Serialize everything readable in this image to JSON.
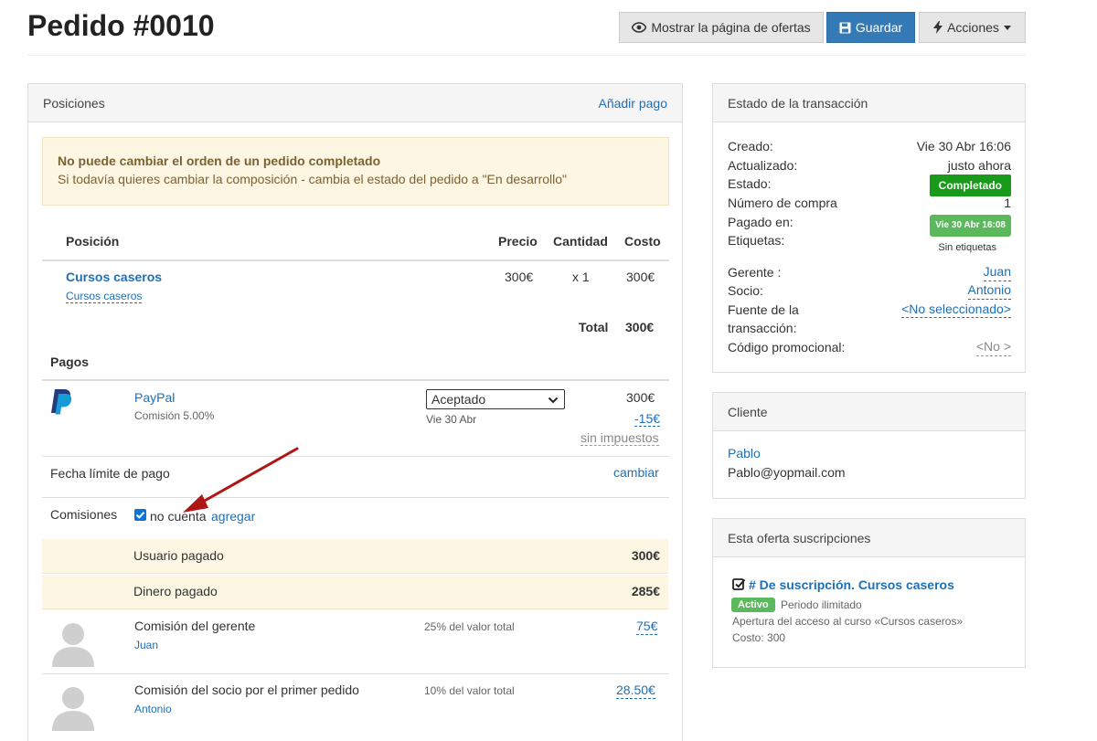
{
  "header": {
    "title": "Pedido #0010",
    "show_offers_label": "Mostrar la página de ofertas",
    "save_label": "Guardar",
    "actions_label": "Acciones"
  },
  "positions": {
    "heading": "Posiciones",
    "add_payment": "Añadir pago",
    "alert_title": "No puede cambiar el orden de un pedido completado",
    "alert_text": "Si todavía quieres cambiar la composición - cambia el estado del pedido a \"En desarrollo\"",
    "columns": {
      "position": "Posición",
      "price": "Precio",
      "quantity": "Cantidad",
      "cost": "Costo"
    },
    "item": {
      "name": "Cursos caseros",
      "sub": "Cursos caseros",
      "price": "300€",
      "quantity": "x 1",
      "cost": "300€"
    },
    "total_label": "Total",
    "total_value": "300€"
  },
  "payments": {
    "heading": "Pagos",
    "method": "PayPal",
    "commission": "Comisión 5.00%",
    "status": "Aceptado",
    "date": "Vie 30 Abr",
    "amount": "300€",
    "fee": "-15€",
    "tax": "sin impuestos"
  },
  "deadline": {
    "label": "Fecha límite de pago",
    "action": "cambiar"
  },
  "commissions": {
    "label": "Comisiones",
    "checkbox_label": "no cuenta",
    "add": "agregar",
    "user_paid_label": "Usuario pagado",
    "user_paid_value": "300€",
    "money_paid_label": "Dinero pagado",
    "money_paid_value": "285€",
    "rows": [
      {
        "title": "Comisión del gerente",
        "person": "Juan",
        "rate": "25% del valor total",
        "amount": "75€"
      },
      {
        "title": "Comisión del socio por el primer pedido",
        "person": "Antonio",
        "rate": "10% del valor total",
        "amount": "28.50€"
      }
    ]
  },
  "transaction": {
    "heading": "Estado de la transacción",
    "created_label": "Creado:",
    "created_value": "Vie 30 Abr 16:06",
    "updated_label": "Actualizado:",
    "updated_value": "justo ahora",
    "status_label": "Estado:",
    "status_value": "Completado",
    "purchase_label": "Número de compra",
    "purchase_value": "1",
    "paid_label": "Pagado en:",
    "paid_value": "Vie 30 Abr 16:08",
    "tags_label": "Etiquetas:",
    "tags_value": "Sin etiquetas",
    "manager_label": "Gerente :",
    "manager_value": "Juan",
    "partner_label": "Socio:",
    "partner_value": "Antonio",
    "source_label_1": "Fuente de la",
    "source_label_2": "transacción:",
    "source_value": "<No seleccionado>",
    "promo_label": "Código promocional:",
    "promo_value": "<No >"
  },
  "client": {
    "heading": "Cliente",
    "name": "Pablo",
    "email": "Pablo@yopmail.com"
  },
  "subscriptions": {
    "heading": "Esta oferta suscripciones",
    "title": "# De suscripción. Cursos caseros",
    "badge": "Activo",
    "period": "Periodo ilimitado",
    "description": "Apertura del acceso al curso «Cursos caseros»",
    "cost": "Costo: 300"
  },
  "colors": {
    "primary": "#337ab7",
    "link": "#1e6fb8",
    "success": "#1a9a1a",
    "alert_bg": "#fcf6e3",
    "arrow": "#b01515"
  }
}
